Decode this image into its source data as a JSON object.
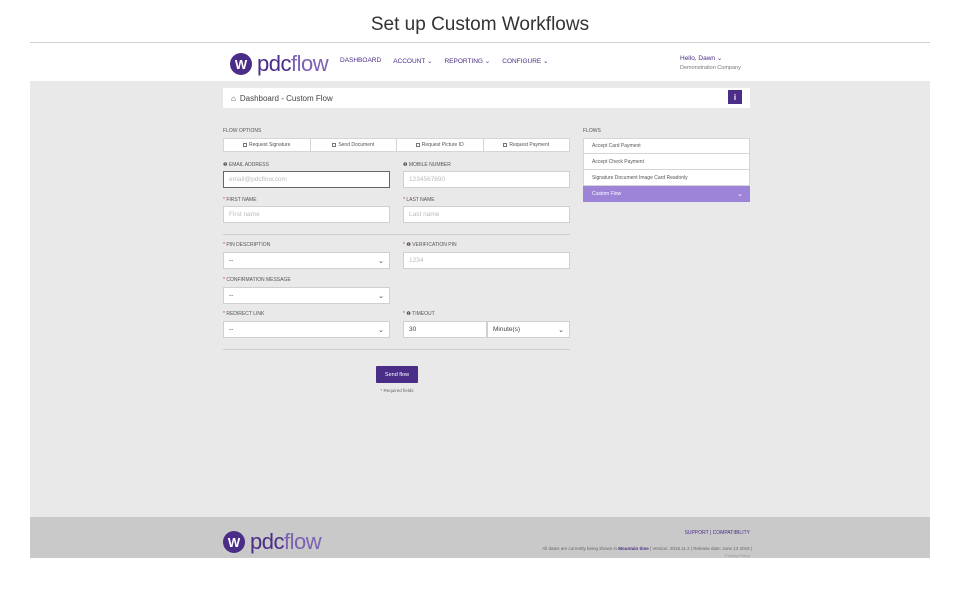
{
  "page_heading": "Set up Custom Workflows",
  "brand": {
    "logo_symbol": "W",
    "name_a": "pdc",
    "name_b": "flow",
    "accent": "#4a2d87",
    "flow_highlight": "#9e84d8"
  },
  "nav": {
    "dashboard": "DASHBOARD",
    "account": "ACCOUNT ⌄",
    "reporting": "REPORTING ⌄",
    "configure": "CONFIGURE ⌄"
  },
  "user": {
    "greeting": "Hello, Dawn ⌄",
    "company": "Demonstration Company"
  },
  "card": {
    "icon": "dashboard-icon",
    "title": "Dashboard - Custom Flow",
    "info": "i"
  },
  "flow_options": {
    "label": "FLOW OPTIONS",
    "options": [
      "Request Signature",
      "Send Document",
      "Request Picture ID",
      "Request Payment"
    ]
  },
  "form": {
    "email_label": "EMAIL ADDRESS",
    "email_placeholder": "email@pdcflow.com",
    "mobile_label": "MOBILE NUMBER",
    "mobile_placeholder": "1234567890",
    "first_label": "FIRST NAME",
    "first_placeholder": "First name",
    "last_label": "LAST NAME",
    "last_placeholder": "Last name",
    "pin_desc_label": "PIN DESCRIPTION",
    "pin_desc_value": "--",
    "verification_label": "VERIFICATION PIN",
    "verification_placeholder": "1234",
    "confirm_label": "CONFIRMATION MESSAGE",
    "confirm_value": "--",
    "redirect_label": "REDIRECT LINK",
    "redirect_value": "--",
    "timeout_label": "TIMEOUT",
    "timeout_value": "30",
    "timeout_unit": "Minute(s)",
    "required_mark": "*",
    "info_mark": "❶"
  },
  "send": {
    "label": "Send flow",
    "note": "* Required fields"
  },
  "flows": {
    "label": "FLOWS",
    "items": [
      "Accept Card Payment",
      "Accept Check Payment",
      "Signature Document Image Card Readonly",
      "Custom Flow"
    ],
    "active_index": 3
  },
  "footer": {
    "support": "SUPPORT",
    "separator": "|",
    "compatibility": "COMPATIBILITY",
    "note_a": "All dates are currently being shown in ",
    "timezone": "Mountain time",
    "note_b": " | Version: 2018.11.2 | Release date: June 13 2018 |",
    "note_c": "Privacy Policy"
  }
}
